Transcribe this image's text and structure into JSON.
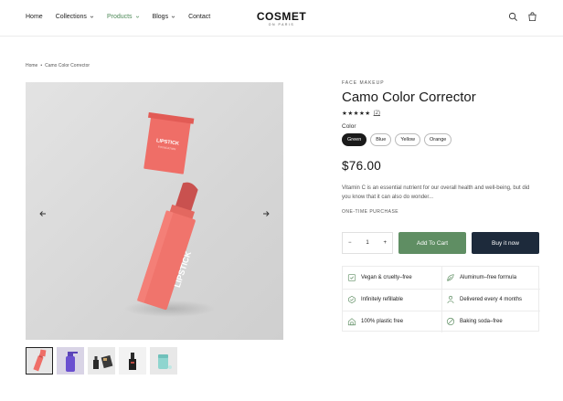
{
  "header": {
    "nav": [
      {
        "label": "Home",
        "has_dropdown": false,
        "active": false
      },
      {
        "label": "Collections",
        "has_dropdown": true,
        "active": false
      },
      {
        "label": "Products",
        "has_dropdown": true,
        "active": true
      },
      {
        "label": "Blogs",
        "has_dropdown": true,
        "active": false
      },
      {
        "label": "Contact",
        "has_dropdown": false,
        "active": false
      }
    ],
    "logo": {
      "main": "COSMET",
      "sub": "ON PARIS"
    },
    "icons": [
      "search-icon",
      "cart-icon"
    ]
  },
  "breadcrumb": {
    "home": "Home",
    "separator": "•",
    "current": "Camo Color Corrector"
  },
  "gallery": {
    "main_image": {
      "description_icon": "lipstick-product-image",
      "box_label_top": "LIPSTICK",
      "box_label_sub": "FOUNDATION",
      "tube_label": "LIPSTICK"
    },
    "thumbnails": [
      "lipstick-thumb",
      "spray-bottle-thumb",
      "dropper-bottles-thumb",
      "serum-bottle-thumb",
      "jar-thumb"
    ]
  },
  "product": {
    "eyebrow": "FACE MAKEUP",
    "title": "Camo Color Corrector",
    "stars": "★★★★★",
    "review_count": "(2)",
    "color_label": "Color",
    "colors": [
      {
        "label": "Green",
        "selected": true
      },
      {
        "label": "Blue",
        "selected": false
      },
      {
        "label": "Yellow",
        "selected": false
      },
      {
        "label": "Orange",
        "selected": false
      }
    ],
    "price": "$76.00",
    "description": "Vitamin C is an essential nutrient for our overall health and well-being, but did you know that it can also do wonder...",
    "purchase_label": "ONE-TIME PURCHASE",
    "quantity": "1",
    "qty_minus": "−",
    "qty_plus": "+",
    "add_to_cart": "Add To Cart",
    "buy_now": "Buy it now"
  },
  "features": [
    {
      "label": "Vegan & cruelty–free",
      "icon": "vegan-icon"
    },
    {
      "label": "Aluminum–free formula",
      "icon": "leaf-icon"
    },
    {
      "label": "Infinitely refillable",
      "icon": "refill-icon"
    },
    {
      "label": "Delivered every 4 months",
      "icon": "delivery-icon"
    },
    {
      "label": "100% plastic free",
      "icon": "house-icon"
    },
    {
      "label": "Baking soda–free",
      "icon": "no-soda-icon"
    }
  ],
  "colors": {
    "accent_green": "#5f8e63",
    "nav_active": "#4e8a58",
    "buy_now_bg": "#1d2a3b",
    "product_pink": "#f0706a"
  }
}
